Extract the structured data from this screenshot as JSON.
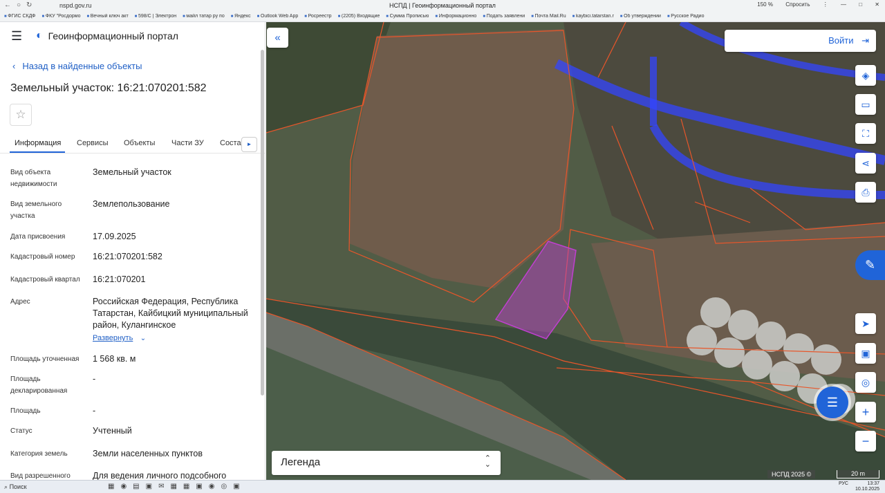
{
  "browser": {
    "url": "nspd.gov.ru",
    "window_title": "НСПД | Геоинформационный портал",
    "zoom": "150 %",
    "ask_label": "Спросить",
    "bookmarks": [
      "ФГИС СКДФ",
      "ФКУ \"Росдормо",
      "Вечный ключ акт",
      "598/С | Электрон",
      "майл татар ру по",
      "Яндекс",
      "Outlook Web App",
      "Росреестр",
      "(2205) Входящие",
      "Сумма Прописью",
      "Информационно",
      "Подать заявлени",
      "Почта Mail.Ru",
      "kaybici.tatarstan.r",
      "Об утверждении",
      "Русское Радио"
    ]
  },
  "sidebar": {
    "app_title": "Геоинформационный портал",
    "back_label": "Назад в найденные объекты",
    "object_title": "Земельный участок: 16:21:070201:582",
    "tabs": [
      "Информация",
      "Сервисы",
      "Объекты",
      "Части ЗУ",
      "Соста"
    ],
    "expand_label": "Развернуть",
    "fields": [
      {
        "label": "Вид объекта недвижимости",
        "value": "Земельный участок"
      },
      {
        "label": "Вид земельного участка",
        "value": "Землепользование"
      },
      {
        "label": "Дата присвоения",
        "value": "17.09.2025"
      },
      {
        "label": "Кадастровый номер",
        "value": "16:21:070201:582"
      },
      {
        "label": "Кадастровый квартал",
        "value": "16:21:070201"
      },
      {
        "label": "Адрес",
        "value": "Российская Федерация, Республика Татарстан, Кайбицкий муниципальный район, Кулангинское"
      },
      {
        "label": "Площадь уточненная",
        "value": "1 568 кв. м"
      },
      {
        "label": "Площадь декларированная",
        "value": "-"
      },
      {
        "label": "Площадь",
        "value": "-"
      },
      {
        "label": "Статус",
        "value": "Учтенный"
      },
      {
        "label": "Категория земель",
        "value": "Земли населенных пунктов"
      },
      {
        "label": "Вид разрешенного",
        "value": "Для ведения личного подсобного"
      }
    ]
  },
  "map": {
    "login_label": "Войти",
    "legend_label": "Легенда",
    "attribution": "НСПД 2025 ©",
    "scale_label": "20 m",
    "colors": {
      "accent": "#2064d8",
      "parcel_border": "#e8562a",
      "selected_parcel": "#c040d0",
      "roads": "#3346ff"
    }
  },
  "taskbar": {
    "search_label": "Поиск",
    "lang": "РУС",
    "time": "13:37",
    "date": "10.10.2025"
  }
}
